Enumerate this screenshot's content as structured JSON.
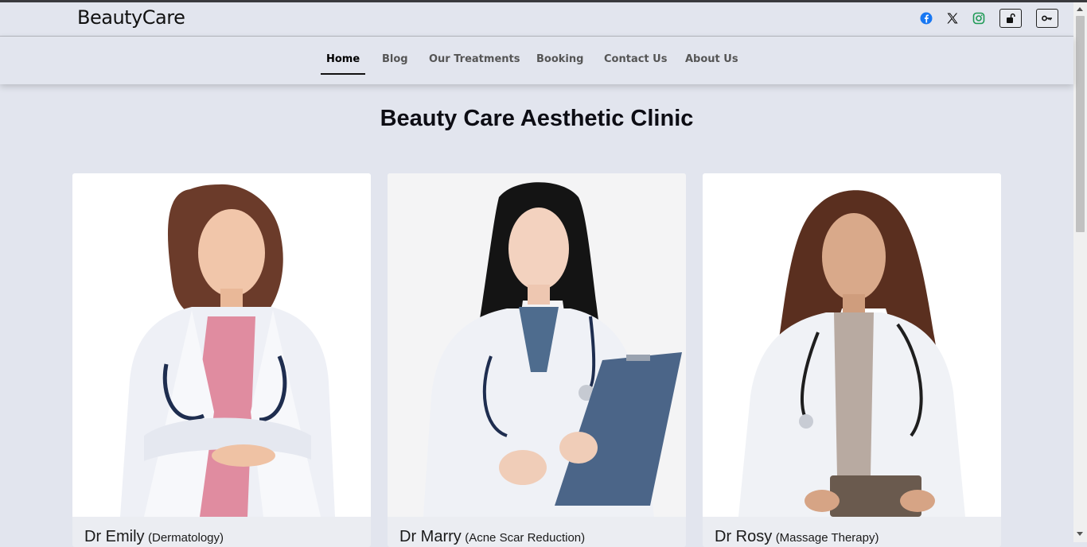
{
  "brand": {
    "logo_text": "BeautyCare"
  },
  "social": [
    {
      "icon": "facebook-icon",
      "color": "#1877f2"
    },
    {
      "icon": "x-twitter-icon",
      "color": "#111111"
    },
    {
      "icon": "instagram-icon",
      "color": "#1e9a55"
    }
  ],
  "auth_buttons": [
    {
      "icon": "unlock-icon"
    },
    {
      "icon": "key-icon"
    }
  ],
  "nav": {
    "items": [
      {
        "label": "Home",
        "active": true
      },
      {
        "label": "Blog"
      },
      {
        "label": "Our Treatments"
      },
      {
        "label": "Booking"
      },
      {
        "label": "Contact Us"
      },
      {
        "label": "About Us"
      }
    ]
  },
  "main": {
    "title": "Beauty Care Aesthetic Clinic",
    "doctors": [
      {
        "name": "Dr Emily",
        "specialty": "(Dermatology)",
        "photo_bg": "#ffffff"
      },
      {
        "name": "Dr Marry",
        "specialty": "(Acne Scar Reduction)",
        "photo_bg": "#f4f4f5"
      },
      {
        "name": "Dr Rosy",
        "specialty": "(Massage Therapy)",
        "photo_bg": "#ffffff"
      }
    ]
  }
}
